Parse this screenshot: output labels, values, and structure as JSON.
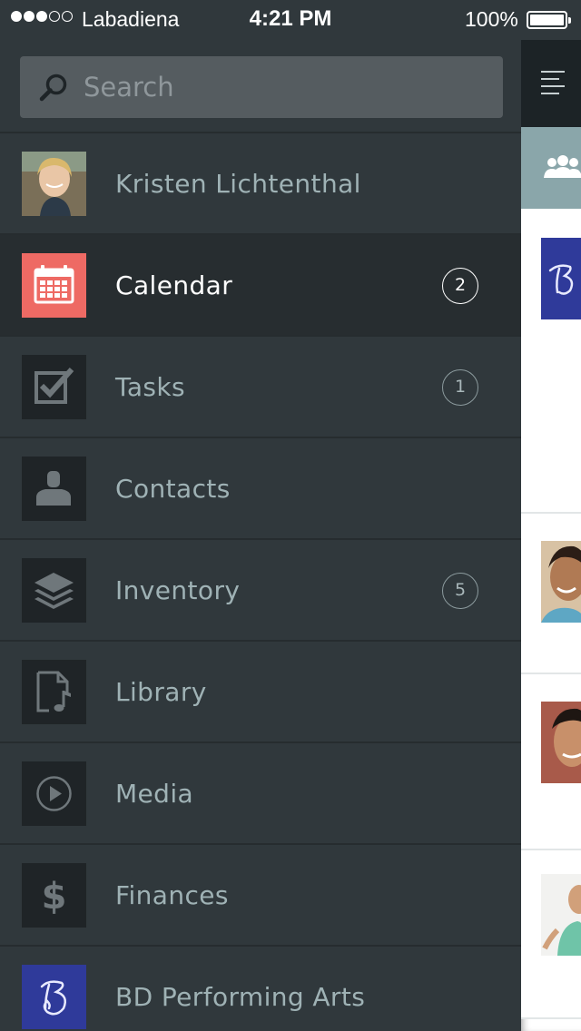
{
  "status_bar": {
    "carrier": "Labadiena",
    "time": "4:21 PM",
    "battery": "100%",
    "signal_bars_filled": 3,
    "signal_bars_total": 5
  },
  "search": {
    "placeholder": "Search",
    "value": ""
  },
  "menu": {
    "items": [
      {
        "label": "Kristen Lichtenthal",
        "icon": "user-avatar",
        "badge": ""
      },
      {
        "label": "Calendar",
        "icon": "calendar-icon",
        "badge": "2",
        "active": true
      },
      {
        "label": "Tasks",
        "icon": "checkbox-icon",
        "badge": "1"
      },
      {
        "label": "Contacts",
        "icon": "person-icon",
        "badge": ""
      },
      {
        "label": "Inventory",
        "icon": "layers-icon",
        "badge": "5"
      },
      {
        "label": "Library",
        "icon": "music-file-icon",
        "badge": ""
      },
      {
        "label": "Media",
        "icon": "play-icon",
        "badge": ""
      },
      {
        "label": "Finances",
        "icon": "dollar-icon",
        "badge": ""
      },
      {
        "label": "BD Performing Arts",
        "icon": "organization-logo",
        "badge": ""
      }
    ]
  },
  "colors": {
    "drawer_bg": "#30383c",
    "active_row_bg": "#272d30",
    "calendar_accent": "#ee6a64",
    "label_color": "#9fb2b5",
    "org_logo_bg": "#2f3a9a",
    "group_bar": "#8aa6aa"
  }
}
